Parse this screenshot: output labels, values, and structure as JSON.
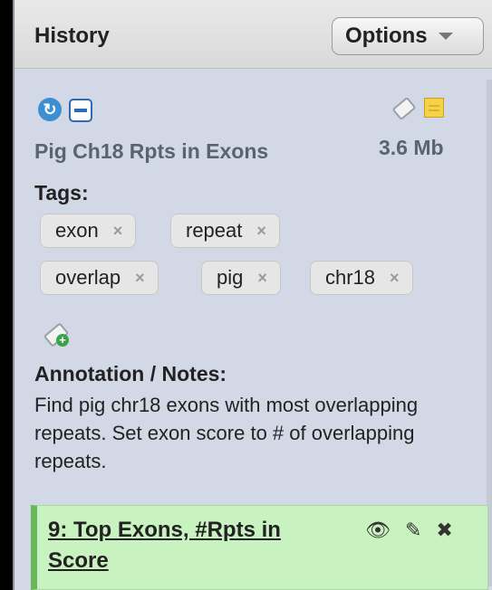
{
  "header": {
    "title": "History",
    "options_label": "Options"
  },
  "dataset": {
    "name": "Pig Ch18 Rpts in Exons",
    "size": "3.6 Mb"
  },
  "tags": {
    "label": "Tags:",
    "items": [
      "exon",
      "repeat",
      "overlap",
      "pig",
      "chr18"
    ],
    "remove_glyph": "×"
  },
  "annotation": {
    "label": "Annotation / Notes:",
    "text": "Find pig chr18 exons with most overlapping repeats. Set exon score to # of overlapping repeats."
  },
  "item": {
    "title": "9: Top Exons, #Rpts in Score"
  },
  "icons": {
    "refresh": "refresh-icon",
    "collapse": "collapse-icon",
    "tag": "tag-icon",
    "note": "note-icon",
    "add_tag": "add-tag-icon",
    "eye": "eye-icon",
    "pencil": "pencil-icon",
    "delete": "delete-icon"
  },
  "colors": {
    "panel_bg": "#d3d8e6",
    "item_bg": "#c8f3c0",
    "item_border": "#68b758",
    "accent_blue": "#3c8fd2"
  }
}
